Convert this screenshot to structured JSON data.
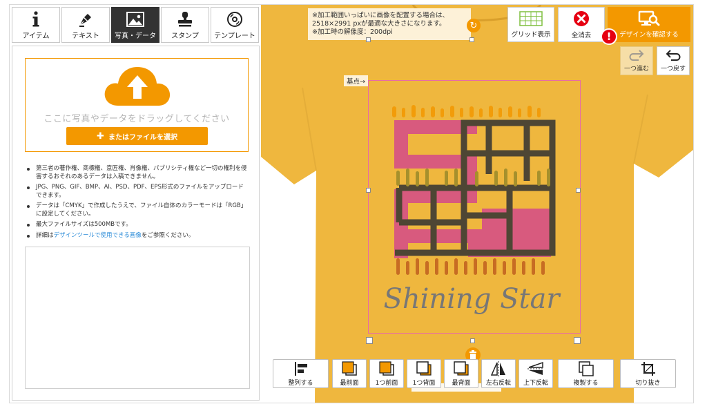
{
  "tabs": [
    {
      "label": "アイテム",
      "icon": "info-icon",
      "active": false
    },
    {
      "label": "テキスト",
      "icon": "pen-nib-icon",
      "active": false
    },
    {
      "label": "写真・データ",
      "icon": "image-icon",
      "active": true
    },
    {
      "label": "スタンプ",
      "icon": "stamp-icon",
      "active": false
    },
    {
      "label": "テンプレート",
      "icon": "disc-icon",
      "active": false
    }
  ],
  "upload": {
    "drop_text": "ここに写真やデータをドラッグしてください",
    "file_button": "またはファイルを選択"
  },
  "notes": {
    "n1": "第三者の著作権、商標権、意匠権、肖像権、パブリシティ権など一切の権利を侵害するおそれのあるデータは入稿できません。",
    "n2": "JPG、PNG、GIF、BMP、AI、PSD、PDF、EPS形式のファイルをアップロードできます。",
    "n3": "データは「CMYK」で作成したうえで、ファイル自体のカラーモードは「RGB」に設定してください。",
    "n4": "最大ファイルサイズは500MBです。",
    "n5_prefix": "詳細は",
    "n5_link": "デザインツールで使用できる画像",
    "n5_suffix": "をご参照ください。"
  },
  "notice": {
    "line1": "※加工範囲いっぱいに画像を配置する場合は、",
    "line2": "2518×2991 pxが最適な大きさになります。",
    "line3": "※加工時の解像度：200dpi"
  },
  "basepoint": "基点→",
  "design_text": "Shining Star",
  "top_buttons": {
    "grid": "グリッド表示",
    "clear": "全消去",
    "confirm": "デザインを確認する",
    "alert": "!"
  },
  "history": {
    "redo": "一つ進む",
    "undo": "一つ戻す"
  },
  "bottom_buttons": {
    "align": "整列する",
    "front_most": "最前面",
    "forward": "1つ前面",
    "backward": "1つ背面",
    "back_most": "最背面",
    "flip_h": "左右反転",
    "flip_v": "上下反転",
    "duplicate": "複製する",
    "crop": "切り抜き"
  },
  "colors": {
    "accent": "#f39800",
    "shirt": "#efb73e",
    "selection": "#e86aa6",
    "alert": "#e60012",
    "link": "#2a8bd8"
  }
}
